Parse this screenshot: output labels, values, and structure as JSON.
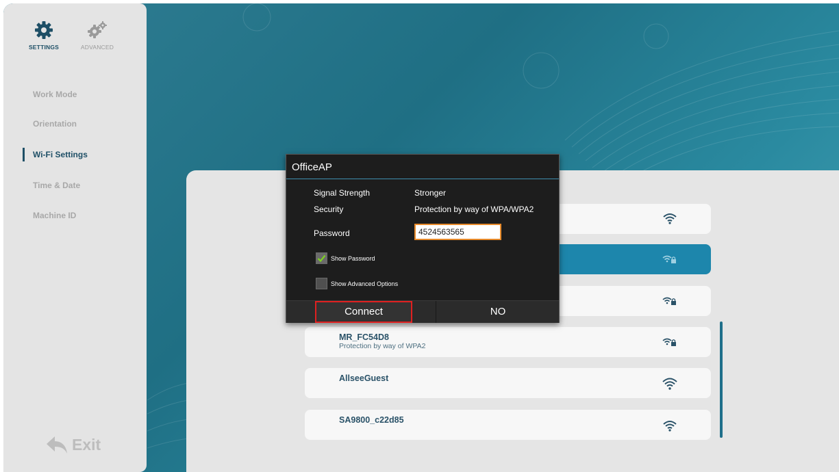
{
  "sidebar": {
    "tabs": [
      {
        "label": "SETTINGS",
        "icon": "gear-icon",
        "active": true
      },
      {
        "label": "ADVANCED",
        "icon": "gears-icon",
        "active": false
      }
    ],
    "items": [
      {
        "label": "Work Mode",
        "active": false
      },
      {
        "label": "Orientation",
        "active": false
      },
      {
        "label": "Wi-Fi Settings",
        "active": true
      },
      {
        "label": "Time & Date",
        "active": false
      },
      {
        "label": "Machine ID",
        "active": false
      }
    ],
    "exit_label": "Exit"
  },
  "networks": [
    {
      "name": "",
      "subtitle": "",
      "secured": false,
      "selected": false
    },
    {
      "name": "",
      "subtitle": "",
      "secured": true,
      "selected": true
    },
    {
      "name": "",
      "subtitle": "",
      "secured": true,
      "selected": false
    },
    {
      "name": "MR_FC54D8",
      "subtitle": "Protection by way of WPA2",
      "secured": true,
      "selected": false
    },
    {
      "name": "AllseeGuest",
      "subtitle": "",
      "secured": false,
      "selected": false
    },
    {
      "name": "SA9800_c22d85",
      "subtitle": "",
      "secured": false,
      "selected": false
    }
  ],
  "dialog": {
    "title": "OfficeAP",
    "signal_label": "Signal Strength",
    "signal_value": "Stronger",
    "security_label": "Security",
    "security_value": "Protection by way of WPA/WPA2",
    "password_label": "Password",
    "password_value": "4524563565",
    "show_password_label": "Show Password",
    "show_password_checked": true,
    "advanced_label": "Show Advanced Options",
    "advanced_checked": false,
    "connect_label": "Connect",
    "no_label": "NO"
  },
  "colors": {
    "accent": "#1d86ac",
    "sidebar_active": "#1e4f66",
    "focus_border": "#e02020",
    "input_border": "#e88a2a"
  }
}
